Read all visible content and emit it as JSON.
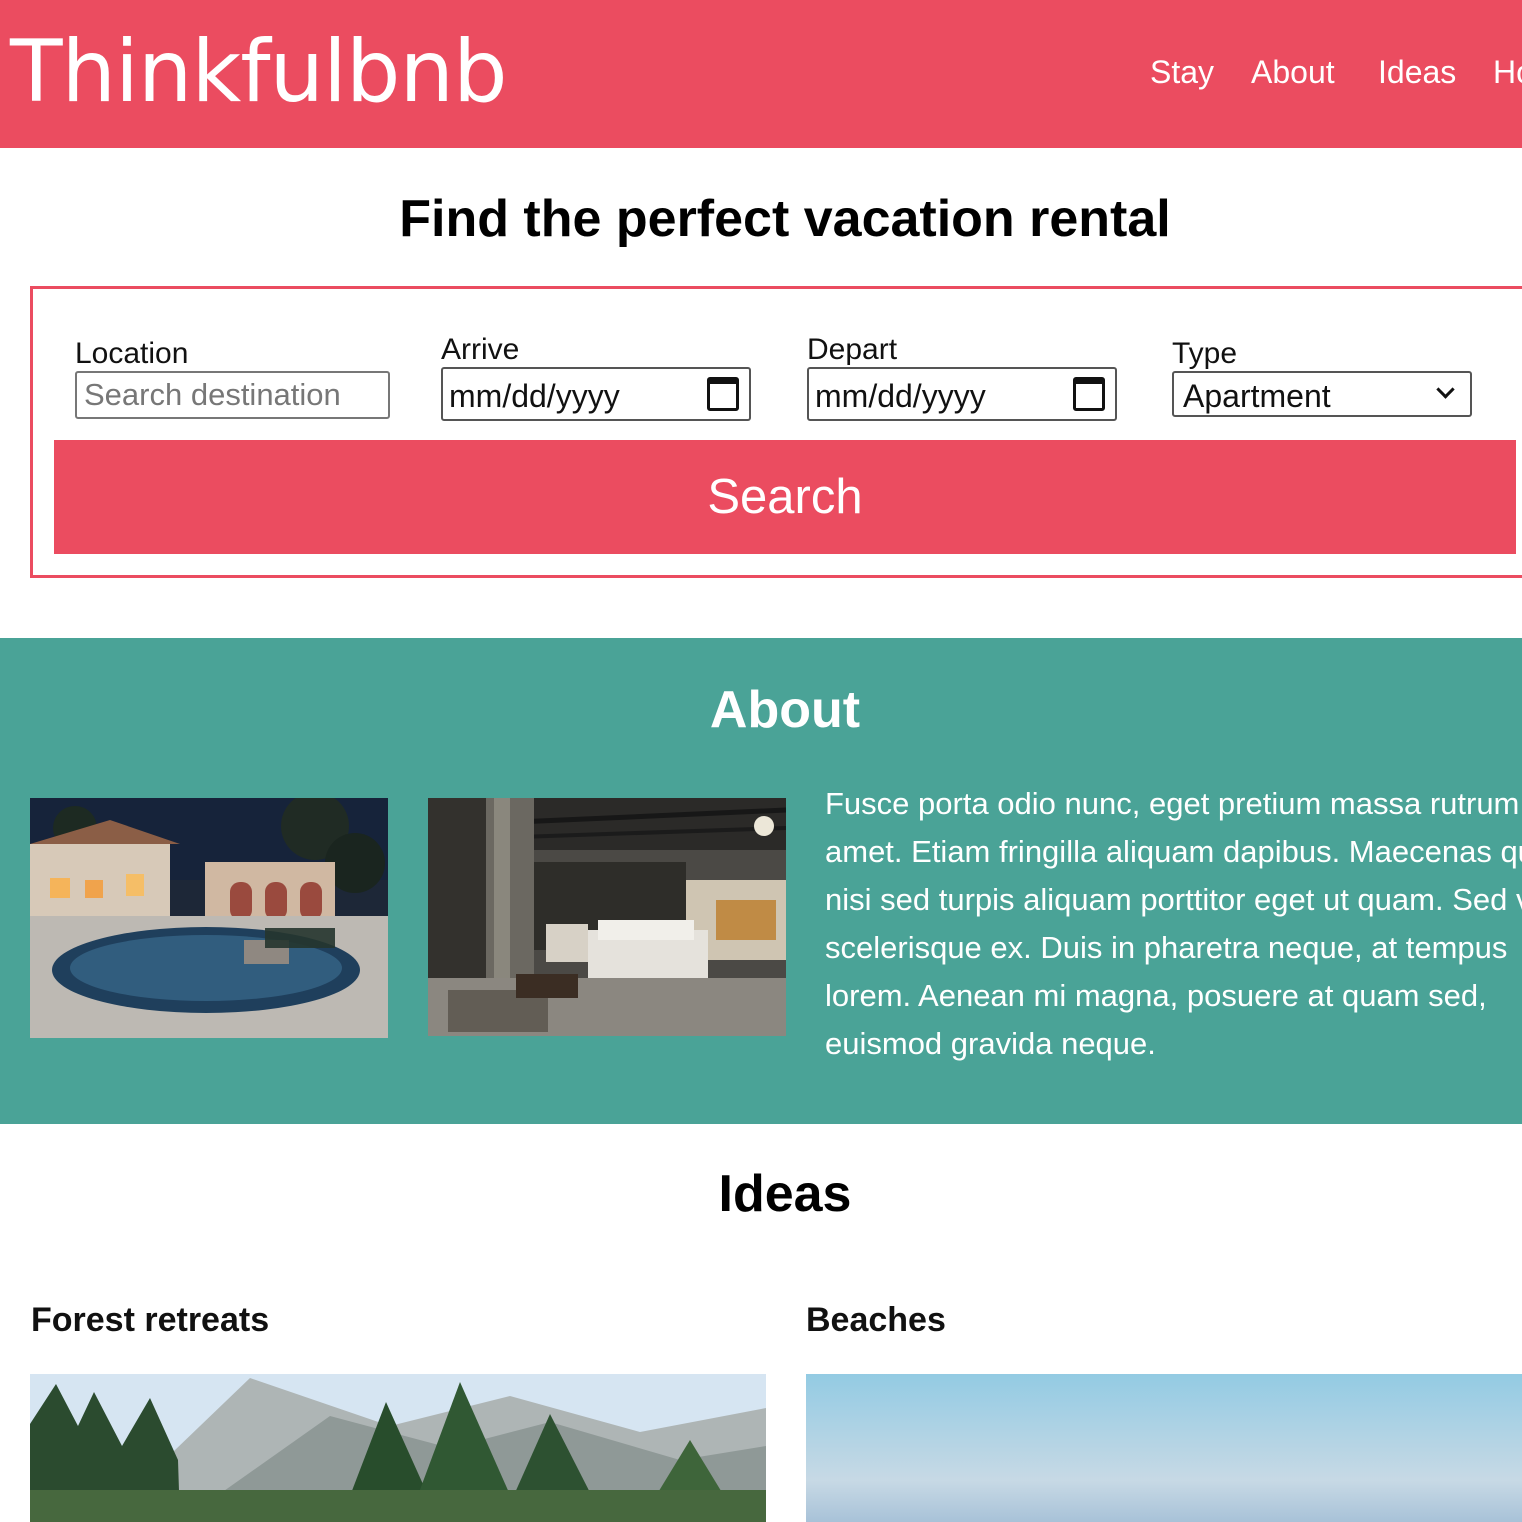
{
  "header": {
    "logo": "Thinkfulbnb",
    "nav": [
      {
        "label": "Stay"
      },
      {
        "label": "About"
      },
      {
        "label": "Ideas"
      },
      {
        "label": "Ho"
      }
    ],
    "brand_color": "#eb4c60"
  },
  "hero": {
    "title": "Find the perfect vacation rental"
  },
  "search": {
    "location_label": "Location",
    "location_placeholder": "Search destination",
    "arrive_label": "Arrive",
    "arrive_value": "mm/dd/yyyy",
    "depart_label": "Depart",
    "depart_value": "mm/dd/yyyy",
    "type_label": "Type",
    "type_value": "Apartment",
    "button_label": "Search",
    "calendar_icon": "calendar-icon",
    "dropdown_icon": "chevron-down-icon"
  },
  "about": {
    "title": "About",
    "text": "Fusce porta odio nunc, eget pretium massa rutrum sit amet. Etiam fringilla aliquam dapibus. Maecenas quis nisi sed turpis aliquam porttitor eget ut quam. Sed vel scelerisque ex. Duis in pharetra neque, at tempus lorem. Aenean mi magna, posuere at quam sed, euismod gravida neque.",
    "background_color": "#4aa397"
  },
  "ideas": {
    "title": "Ideas",
    "cards": [
      {
        "title": "Forest retreats"
      },
      {
        "title": "Beaches"
      }
    ]
  }
}
